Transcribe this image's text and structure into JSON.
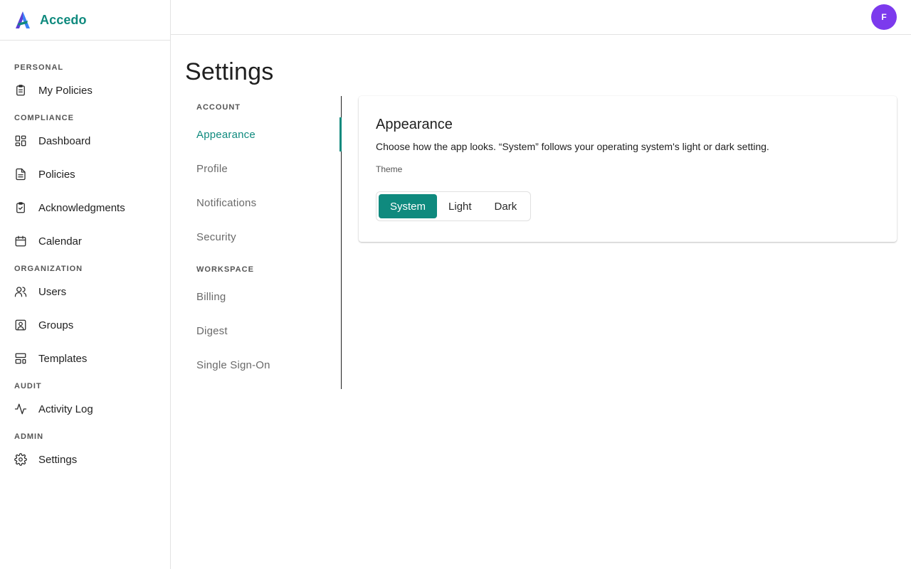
{
  "brand": {
    "name": "Accedo",
    "logo_icon": "accedo-logo-icon",
    "logo_colors": [
      "#5b3fd6",
      "#0f8a7e",
      "#3b82f6"
    ]
  },
  "sidebar": {
    "sections": [
      {
        "label": "PERSONAL",
        "items": [
          {
            "label": "My Policies",
            "icon": "clipboard-icon"
          }
        ]
      },
      {
        "label": "COMPLIANCE",
        "items": [
          {
            "label": "Dashboard",
            "icon": "dashboard-grid-icon"
          },
          {
            "label": "Policies",
            "icon": "document-icon"
          },
          {
            "label": "Acknowledgments",
            "icon": "clipboard-check-icon"
          },
          {
            "label": "Calendar",
            "icon": "calendar-icon"
          }
        ]
      },
      {
        "label": "ORGANIZATION",
        "items": [
          {
            "label": "Users",
            "icon": "users-icon"
          },
          {
            "label": "Groups",
            "icon": "user-square-icon"
          },
          {
            "label": "Templates",
            "icon": "layout-template-icon"
          }
        ]
      },
      {
        "label": "AUDIT",
        "items": [
          {
            "label": "Activity Log",
            "icon": "activity-icon"
          }
        ]
      },
      {
        "label": "ADMIN",
        "items": [
          {
            "label": "Settings",
            "icon": "gear-icon"
          }
        ]
      }
    ]
  },
  "topbar": {
    "avatar_initial": "F",
    "avatar_color": "#7c3aed"
  },
  "page": {
    "title": "Settings"
  },
  "settings_nav": {
    "account_label": "ACCOUNT",
    "account_items": [
      "Appearance",
      "Profile",
      "Notifications",
      "Security"
    ],
    "workspace_label": "WORKSPACE",
    "workspace_items": [
      "Billing",
      "Digest",
      "Single Sign-On"
    ],
    "active": "Appearance"
  },
  "appearance": {
    "title": "Appearance",
    "description": "Choose how the app looks. “System” follows your operating system's light or dark setting.",
    "theme_label": "Theme",
    "options": [
      "System",
      "Light",
      "Dark"
    ],
    "selected": "System"
  },
  "colors": {
    "accent": "#0f8a7e",
    "text": "#1f1f1f",
    "muted": "#6a6a6a",
    "border": "#e3e3e3"
  }
}
